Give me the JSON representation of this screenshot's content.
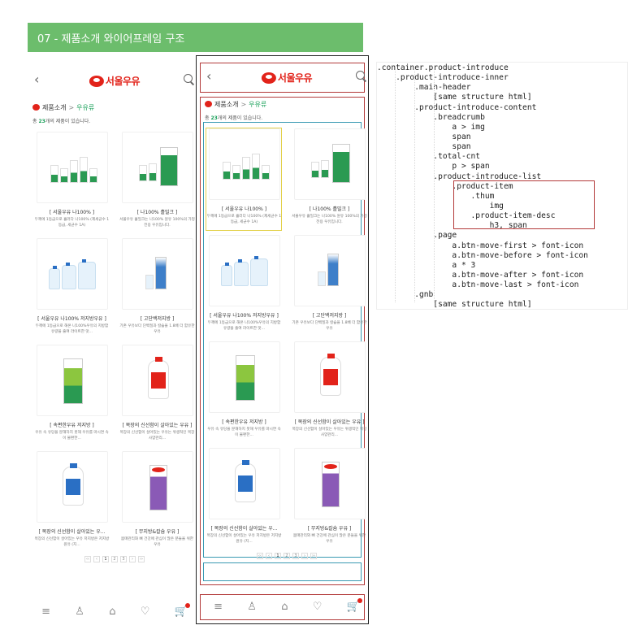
{
  "title_bar": "07 - 제품소개 와이어프레임 구조",
  "logo_text": "서울우유",
  "breadcrumb": {
    "home": "제품소개",
    "sep": ">",
    "current": "우유류"
  },
  "total": {
    "prefix": "총 ",
    "count": "23",
    "suffix": "개의 제품이 있습니다."
  },
  "products": [
    {
      "name": "[ 서울우유 나100% ]",
      "desc": "두께에 1등급으로 흘러다 나100% (제세균수 1등급, 세균수 1A)"
    },
    {
      "name": "[ 나100% 흘밀크 ]",
      "desc": "서울우유 흘밀크는 나100% 원유 100%의 가정전용 우유입니다."
    },
    {
      "name": "[ 서울우유 나100% 저지방우유 ]",
      "desc": "두께에 1등급으로 해온 나100%우유의 지방함유량을 줄여 라이트한 맛..."
    },
    {
      "name": "[ 고단백저지방 ]",
      "desc": "기존 우유보다 단백질과 칼슘을 1.8배 더 함유한 우유"
    },
    {
      "name": "[ 속편한우유 저지방 ]",
      "desc": "우유 속 유당을 분해하지 못해 우유를 마시면 속이 불편한..."
    },
    {
      "name": "[ 목장의 신선함이 살아있는 우유 ]",
      "desc": "목장의 신선함이 살아있는 우유는 위생적인 목장 사양관리..."
    },
    {
      "name": "[ 목장의 신선함이 살아있는 우...",
      "desc": "목장의 신선함이 살아있는 우유 저지방은 저지방 원유 (지..."
    },
    {
      "name": "[ 무지방&칼슘 우유 ]",
      "desc": "몸매관리와 뼈 건강에 관심이 많은 분들을 위한 우유"
    }
  ],
  "pager": [
    "‹‹",
    "‹",
    "1",
    "2",
    "3",
    "›",
    "››"
  ],
  "gnb": [
    "≡",
    "♙",
    "⌂",
    "♡",
    "🛒"
  ],
  "code_lines": [
    ".container.product-introduce",
    "    .product-introduce-inner",
    "        .main-header",
    "            [same structure html]",
    "        .product-introduce-content",
    "            .breadcrumb",
    "                a > img",
    "                span",
    "                span",
    "            .total-cnt",
    "                p > span",
    "            .product-introduce-list",
    "                .product-item",
    "                    .thum",
    "                        img",
    "                    .product-item-desc",
    "                        h3, span",
    "            .page",
    "                a.btn-move-first > font-icon",
    "                a.btn-move-before > font-icon",
    "                a * 3",
    "                a.btn-move-after > font-icon",
    "                a.btn-move-last > font-icon",
    "        .gnb",
    "            [same structure html]"
  ],
  "colors": {
    "brand_red": "#e2231a",
    "accent_green": "#1aa05a",
    "title_bar_green": "#6cbd6c"
  }
}
